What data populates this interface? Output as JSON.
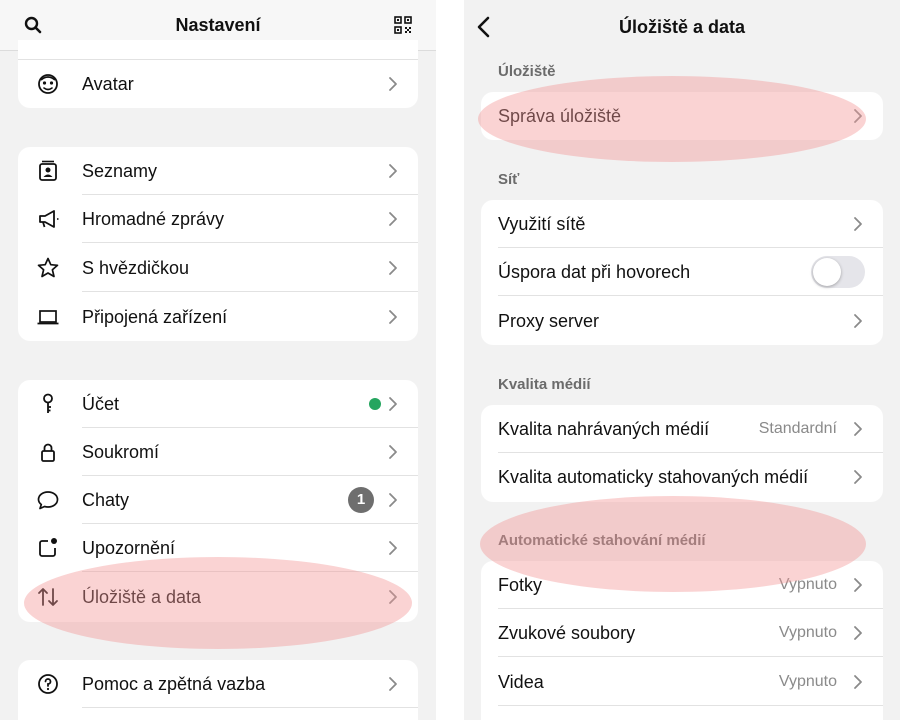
{
  "left": {
    "title": "Nastavení",
    "rows": {
      "avatar": "Avatar",
      "lists": "Seznamy",
      "broadcast": "Hromadné zprávy",
      "starred": "S hvězdičkou",
      "devices": "Připojená zařízení",
      "account": "Účet",
      "privacy": "Soukromí",
      "chats": "Chaty",
      "chats_badge": "1",
      "notifications": "Upozornění",
      "storage": "Úložiště a data",
      "help": "Pomoc a zpětná vazba"
    }
  },
  "right": {
    "title": "Úložiště a data",
    "sections": {
      "storage": "Úložiště",
      "network": "Síť",
      "media_quality": "Kvalita médií",
      "auto_download": "Automatické stahování médií"
    },
    "rows": {
      "manage_storage": "Správa úložiště",
      "network_usage": "Využití sítě",
      "data_saver": "Úspora dat při hovorech",
      "proxy": "Proxy server",
      "upload_quality": "Kvalita nahrávaných médií",
      "upload_quality_value": "Standardní",
      "auto_quality": "Kvalita automaticky stahovaných médií",
      "photos": "Fotky",
      "photos_value": "Vypnuto",
      "audio": "Zvukové soubory",
      "audio_value": "Vypnuto",
      "video": "Videa",
      "video_value": "Vypnuto"
    }
  },
  "colors": {
    "online_dot": "#25a55f",
    "badge": "#6e6e6e",
    "highlight": "#f29696"
  },
  "toggle": {
    "data_saver_on": false
  }
}
